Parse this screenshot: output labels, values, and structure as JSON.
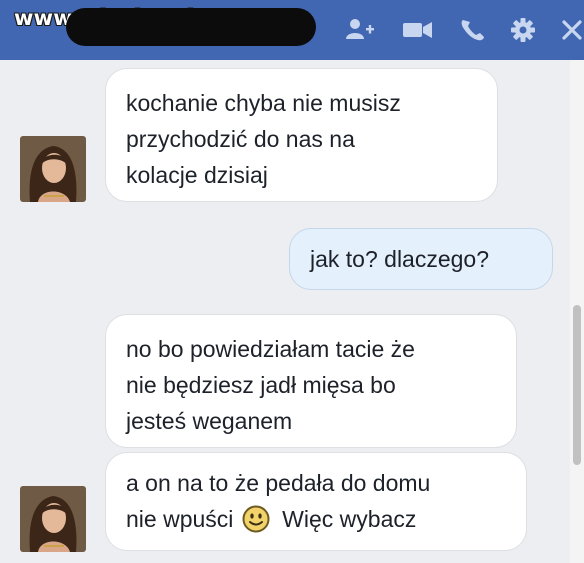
{
  "header": {
    "watermark": "www.wiocha.pl",
    "icons": [
      "add-friend-icon",
      "video-call-icon",
      "phone-icon",
      "gear-icon",
      "close-icon"
    ],
    "background_color": "#4267b2"
  },
  "messages": [
    {
      "sender": "other",
      "lines": [
        "kochanie chyba nie musisz",
        "przychodzić do nas na",
        "kolacje dzisiaj"
      ]
    },
    {
      "sender": "me",
      "lines": [
        "jak to? dlaczego?"
      ]
    },
    {
      "sender": "other",
      "lines": [
        "no bo powiedziałam tacie że",
        "nie będziesz jadł mięsa bo",
        "jesteś weganem"
      ]
    },
    {
      "sender": "other",
      "lines": [
        "a on na to że pedała do domu"
      ],
      "line2_before": "nie wpuści",
      "line2_after": "Więc wybacz",
      "emoji": "smiley-emoji"
    }
  ],
  "colors": {
    "incoming_bubble": "#ffffff",
    "outgoing_bubble": "#e4f0fb",
    "chat_background": "#eceef1"
  }
}
